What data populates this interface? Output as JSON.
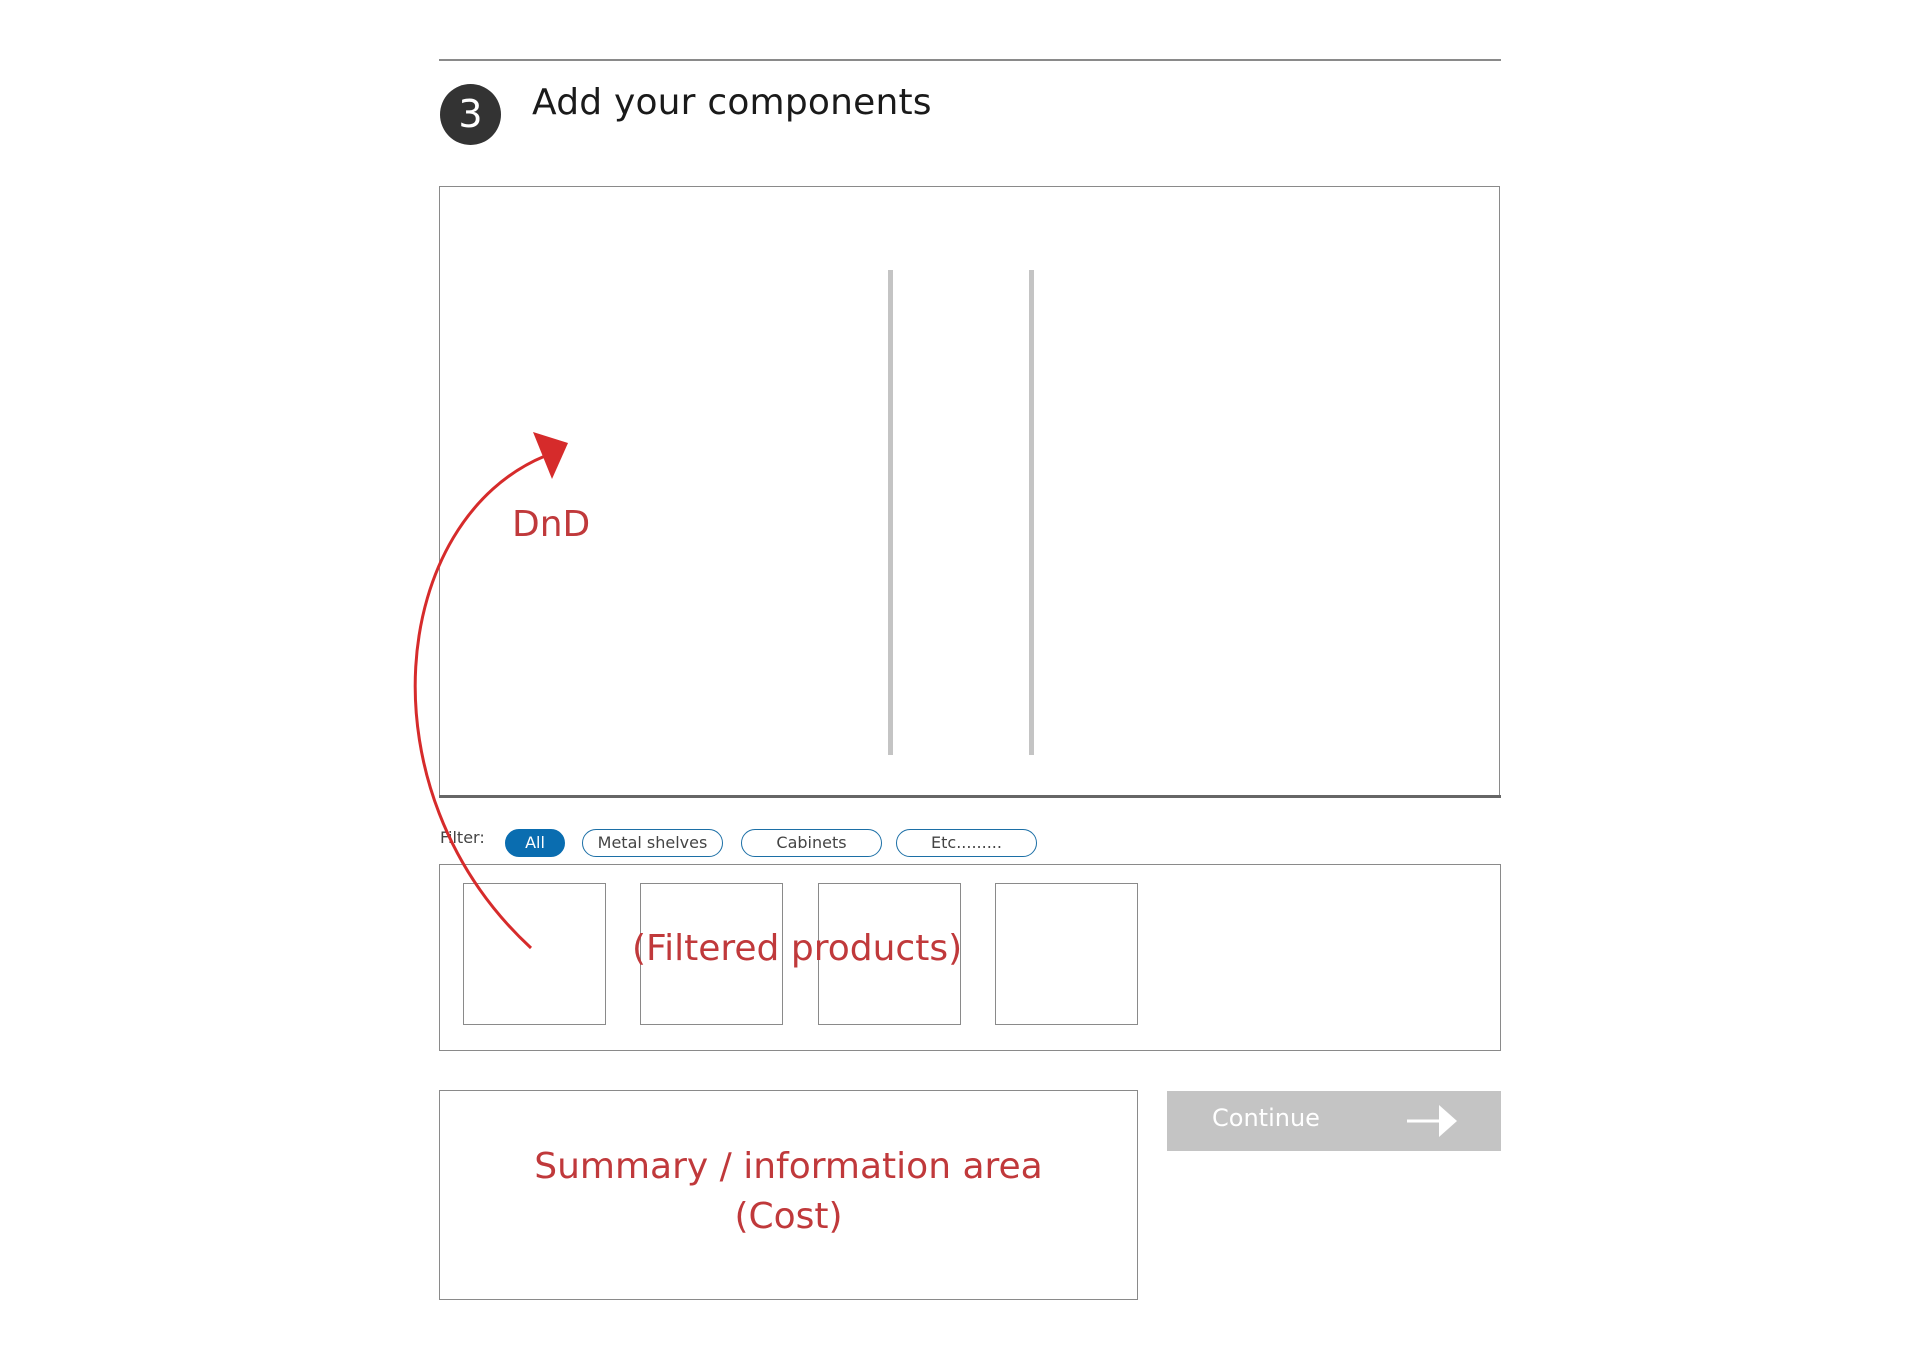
{
  "step": {
    "number": "3",
    "title": "Add your components"
  },
  "filter": {
    "label": "Filter:",
    "chips": [
      {
        "label": "All",
        "selected": true
      },
      {
        "label": "Metal shelves",
        "selected": false
      },
      {
        "label": "Cabinets",
        "selected": false
      },
      {
        "label": "Etc.........",
        "selected": false
      }
    ]
  },
  "annotations": {
    "dnd": "DnD",
    "products_note": "(Filtered products)",
    "summary_line_1": "Summary / information area",
    "summary_line_2": "(Cost)"
  },
  "continue_button": {
    "label": "Continue",
    "icon": "arrow-right-icon"
  },
  "colors": {
    "annotation_red": "#c0393b",
    "chip_selected": "#0a6db0",
    "chip_outline": "#1c6fa6",
    "button_disabled": "#c4c4c4",
    "step_circle": "#333333"
  }
}
